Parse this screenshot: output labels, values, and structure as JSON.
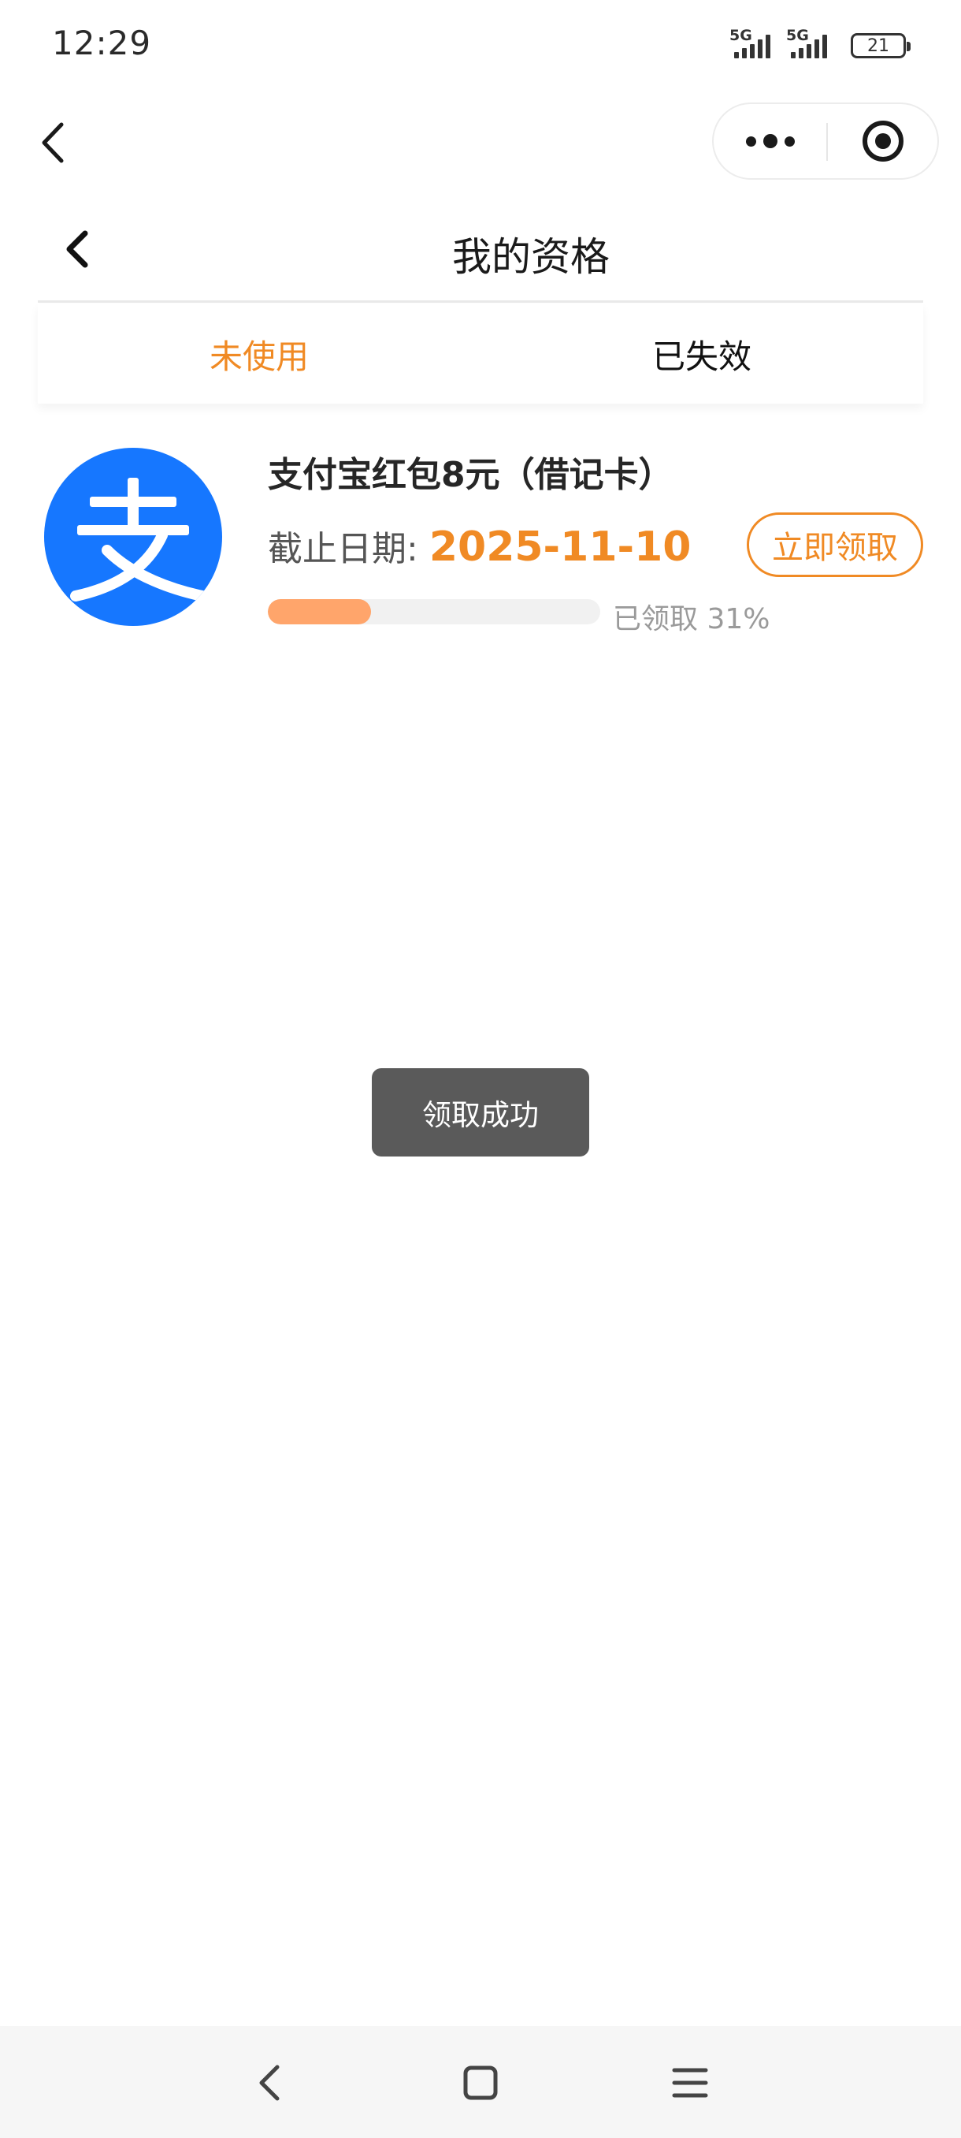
{
  "status_bar": {
    "time": "12:29",
    "sim1_network": "5G",
    "sim2_network": "5G",
    "battery_level": "21"
  },
  "mini_program_nav": {
    "back_icon": "chevron-left-icon",
    "more_icon": "more-dots-icon",
    "close_icon": "target-close-icon"
  },
  "page": {
    "title": "我的资格",
    "back_icon": "chevron-left-icon"
  },
  "tabs": [
    {
      "label": "未使用",
      "active": true
    },
    {
      "label": "已失效",
      "active": false
    }
  ],
  "coupon": {
    "logo_icon": "alipay-logo-icon",
    "logo_color": "#1677ff",
    "title": "支付宝红包8元（借记卡）",
    "deadline_label": "截止日期:",
    "deadline_value": "2025-11-10",
    "claim_button": "立即领取",
    "progress_fraction": 0.31,
    "progress_text": "已领取 31%"
  },
  "toast": {
    "message": "领取成功"
  },
  "system_nav": {
    "back_icon": "back-triangle-icon",
    "home_icon": "home-square-icon",
    "menu_icon": "menu-lines-icon"
  },
  "colors": {
    "accent": "#f08a24",
    "progress_fill": "#ffa56b",
    "toast_bg": "#5a5a5a"
  }
}
